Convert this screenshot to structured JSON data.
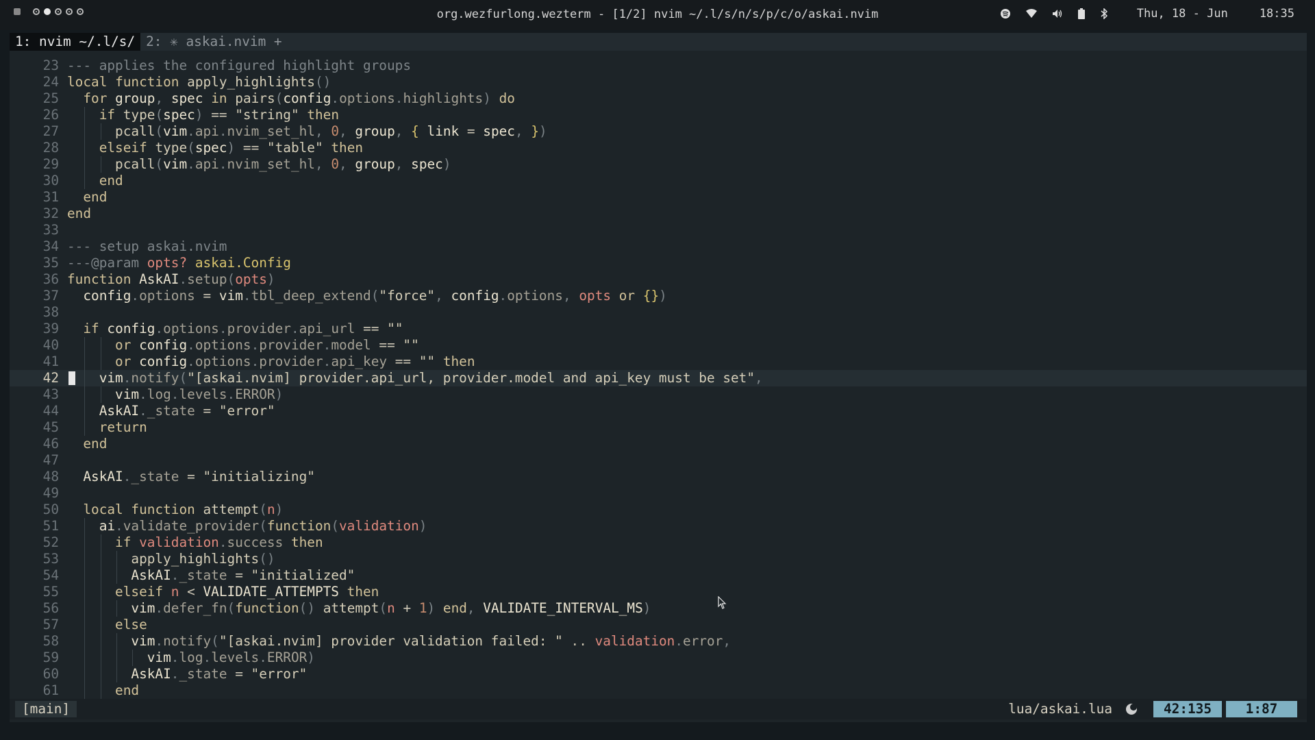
{
  "topbar": {
    "window_title": "org.wezfurlong.wezterm - [1/2] nvim ~/.l/s/n/s/p/c/o/askai.nvim",
    "date": "Thu, 18 - Jun",
    "time": "18:35",
    "tray_icons": [
      "spotify-icon",
      "wifi-icon",
      "volume-icon",
      "battery-icon",
      "bluetooth-icon"
    ]
  },
  "tabs": [
    {
      "label": "1: nvim ~/.l/s/"
    },
    {
      "label": "2: ✳ askai.nvim +"
    }
  ],
  "editor": {
    "cursor_line": 42,
    "lines": [
      {
        "n": "23",
        "text": "--- applies the configured highlight groups"
      },
      {
        "n": "24",
        "text": "local function apply_highlights()"
      },
      {
        "n": "25",
        "text": "  for group, spec in pairs(config.options.highlights) do"
      },
      {
        "n": "26",
        "text": "    if type(spec) == \"string\" then"
      },
      {
        "n": "27",
        "text": "      pcall(vim.api.nvim_set_hl, 0, group, { link = spec, })"
      },
      {
        "n": "28",
        "text": "    elseif type(spec) == \"table\" then"
      },
      {
        "n": "29",
        "text": "      pcall(vim.api.nvim_set_hl, 0, group, spec)"
      },
      {
        "n": "30",
        "text": "    end"
      },
      {
        "n": "31",
        "text": "  end"
      },
      {
        "n": "32",
        "text": "end"
      },
      {
        "n": "33",
        "text": ""
      },
      {
        "n": "34",
        "text": "--- setup askai.nvim"
      },
      {
        "n": "35",
        "text": "---@param opts? askai.Config"
      },
      {
        "n": "36",
        "text": "function AskAI.setup(opts)"
      },
      {
        "n": "37",
        "text": "  config.options = vim.tbl_deep_extend(\"force\", config.options, opts or {})"
      },
      {
        "n": "38",
        "text": ""
      },
      {
        "n": "39",
        "text": "  if config.options.provider.api_url == \"\""
      },
      {
        "n": "40",
        "text": "      or config.options.provider.model == \"\""
      },
      {
        "n": "41",
        "text": "      or config.options.provider.api_key == \"\" then"
      },
      {
        "n": "42",
        "text": "    vim.notify(\"[askai.nvim] provider.api_url, provider.model and api_key must be set\","
      },
      {
        "n": "43",
        "text": "      vim.log.levels.ERROR)"
      },
      {
        "n": "44",
        "text": "    AskAI._state = \"error\""
      },
      {
        "n": "45",
        "text": "    return"
      },
      {
        "n": "46",
        "text": "  end"
      },
      {
        "n": "47",
        "text": ""
      },
      {
        "n": "48",
        "text": "  AskAI._state = \"initializing\""
      },
      {
        "n": "49",
        "text": ""
      },
      {
        "n": "50",
        "text": "  local function attempt(n)"
      },
      {
        "n": "51",
        "text": "    ai.validate_provider(function(validation)"
      },
      {
        "n": "52",
        "text": "      if validation.success then"
      },
      {
        "n": "53",
        "text": "        apply_highlights()"
      },
      {
        "n": "54",
        "text": "        AskAI._state = \"initialized\""
      },
      {
        "n": "55",
        "text": "      elseif n < VALIDATE_ATTEMPTS then"
      },
      {
        "n": "56",
        "text": "        vim.defer_fn(function() attempt(n + 1) end, VALIDATE_INTERVAL_MS)"
      },
      {
        "n": "57",
        "text": "      else"
      },
      {
        "n": "58",
        "text": "        vim.notify(\"[askai.nvim] provider validation failed: \" .. validation.error,"
      },
      {
        "n": "59",
        "text": "          vim.log.levels.ERROR)"
      },
      {
        "n": "60",
        "text": "        AskAI._state = \"error\""
      },
      {
        "n": "61",
        "text": "      end"
      }
    ]
  },
  "statusline": {
    "branch": "[main]",
    "file": "lua/askai.lua",
    "position": "42:135",
    "progress": "1:87"
  },
  "colors": {
    "background": "#1d2428",
    "accent": "#7fb0c2",
    "comment": "#7e8589",
    "keyword": "#d3c39a",
    "number": "#c88d6f",
    "param": "#e08a7e"
  }
}
